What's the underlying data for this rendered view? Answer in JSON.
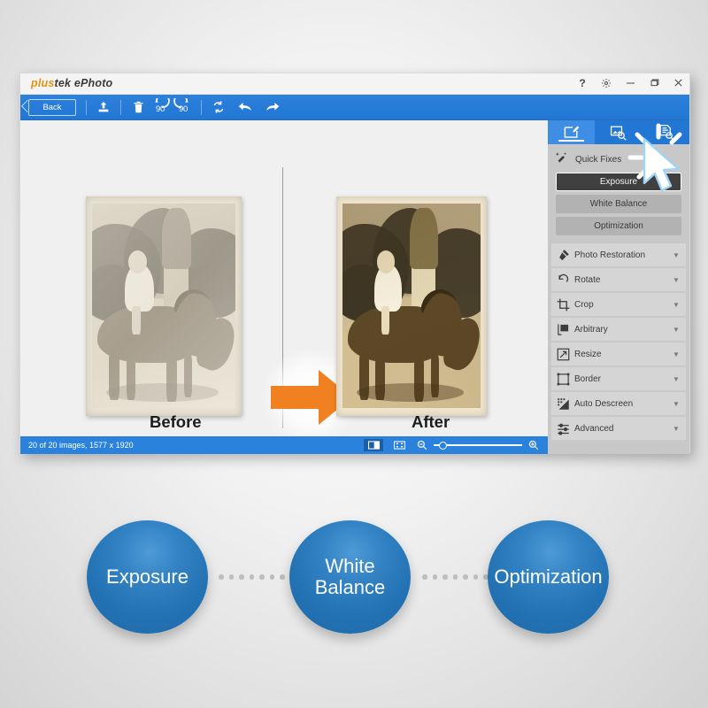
{
  "window": {
    "logo_prefix": "plus",
    "logo_suffix": "tek ePhoto",
    "controls": [
      {
        "name": "help-icon",
        "label": "?"
      },
      {
        "name": "settings-gear-icon",
        "label": "Settings"
      },
      {
        "name": "minimize-button",
        "label": "Minimize"
      },
      {
        "name": "maximize-button",
        "label": "Maximize"
      },
      {
        "name": "close-button",
        "label": "Close"
      }
    ]
  },
  "toolbar": {
    "back_label": "Back",
    "items": [
      {
        "name": "export-icon",
        "label": "Export"
      },
      {
        "name": "delete-icon",
        "label": "Delete"
      },
      {
        "name": "rotate-left-90-icon",
        "label": "90"
      },
      {
        "name": "rotate-right-90-icon",
        "label": "90"
      },
      {
        "name": "reset-icon",
        "label": "Reset"
      },
      {
        "name": "undo-icon",
        "label": "Undo"
      },
      {
        "name": "redo-icon",
        "label": "Redo"
      }
    ]
  },
  "canvas": {
    "before_caption": "Before",
    "after_caption": "After"
  },
  "statusbar": {
    "text": "20 of 20 images, 1577 x 1920",
    "split_view_label": "Split view",
    "fit_view_label": "Fit to window",
    "zoom_out_label": "Zoom out",
    "zoom_in_label": "Zoom in",
    "zoom_value": "6"
  },
  "panel": {
    "tabs": [
      {
        "label": "Edit",
        "icon": "edit-image-icon",
        "active": true
      },
      {
        "label": "Preview",
        "icon": "image-search-icon",
        "active": false
      },
      {
        "label": "Document",
        "icon": "document-search-icon",
        "active": false
      }
    ],
    "quick_fixes": {
      "title": "Quick Fixes",
      "icon": "magic-wand-icon",
      "buttons": [
        {
          "label": "Exposure",
          "selected": true
        },
        {
          "label": "White Balance",
          "selected": false
        },
        {
          "label": "Optimization",
          "selected": false
        }
      ]
    },
    "accordion": [
      {
        "label": "Photo Restoration",
        "icon": "restoration-brush-icon"
      },
      {
        "label": "Rotate",
        "icon": "rotate-icon"
      },
      {
        "label": "Crop",
        "icon": "crop-icon"
      },
      {
        "label": "Arbitrary",
        "icon": "arbitrary-icon"
      },
      {
        "label": "Resize",
        "icon": "resize-icon"
      },
      {
        "label": "Border",
        "icon": "border-icon"
      },
      {
        "label": "Auto Descreen",
        "icon": "descreen-icon"
      },
      {
        "label": "Advanced",
        "icon": "advanced-sliders-icon"
      }
    ],
    "chevron": "▼"
  },
  "diagram": {
    "steps": [
      {
        "label": "Exposure"
      },
      {
        "label": "White\nBalance"
      },
      {
        "label": "Optimization"
      }
    ],
    "connector_dots": 7
  },
  "colors": {
    "toolbar_blue": "#2277d4",
    "status_blue": "#2b82dd",
    "accent_orange": "#f08020",
    "logo_orange": "#e2930f",
    "panel_gray": "#c8c8c8",
    "circle_blue": "#2878bd"
  }
}
